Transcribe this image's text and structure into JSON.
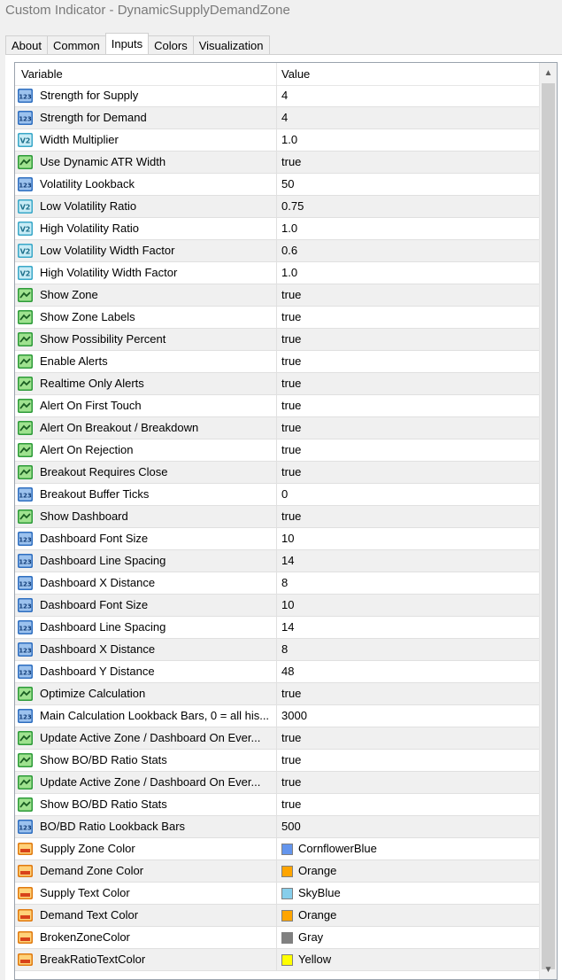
{
  "window": {
    "title": "Custom Indicator - DynamicSupplyDemandZone"
  },
  "tabs": [
    {
      "label": "About",
      "active": false
    },
    {
      "label": "Common",
      "active": false
    },
    {
      "label": "Inputs",
      "active": true
    },
    {
      "label": "Colors",
      "active": false
    },
    {
      "label": "Visualization",
      "active": false
    }
  ],
  "grid": {
    "columns": {
      "variable": "Variable",
      "value": "Value"
    },
    "rows": [
      {
        "type": "int",
        "label": "Strength for Supply",
        "value": "4"
      },
      {
        "type": "int",
        "label": "Strength for Demand",
        "value": "4"
      },
      {
        "type": "double",
        "label": "Width Multiplier",
        "value": "1.0"
      },
      {
        "type": "bool",
        "label": "Use Dynamic ATR Width",
        "value": "true"
      },
      {
        "type": "int",
        "label": "Volatility Lookback",
        "value": "50"
      },
      {
        "type": "double",
        "label": "Low Volatility Ratio",
        "value": "0.75"
      },
      {
        "type": "double",
        "label": "High Volatility Ratio",
        "value": "1.0"
      },
      {
        "type": "double",
        "label": "Low Volatility Width Factor",
        "value": "0.6"
      },
      {
        "type": "double",
        "label": "High Volatility Width Factor",
        "value": "1.0"
      },
      {
        "type": "bool",
        "label": "Show Zone",
        "value": "true"
      },
      {
        "type": "bool",
        "label": "Show Zone Labels",
        "value": "true"
      },
      {
        "type": "bool",
        "label": "Show Possibility Percent",
        "value": "true"
      },
      {
        "type": "bool",
        "label": "Enable Alerts",
        "value": "true"
      },
      {
        "type": "bool",
        "label": "Realtime Only Alerts",
        "value": "true"
      },
      {
        "type": "bool",
        "label": "Alert On First Touch",
        "value": "true"
      },
      {
        "type": "bool",
        "label": "Alert On Breakout / Breakdown",
        "value": "true"
      },
      {
        "type": "bool",
        "label": "Alert On Rejection",
        "value": "true"
      },
      {
        "type": "bool",
        "label": "Breakout Requires Close",
        "value": "true"
      },
      {
        "type": "int",
        "label": "Breakout Buffer Ticks",
        "value": "0"
      },
      {
        "type": "bool",
        "label": "Show Dashboard",
        "value": "true"
      },
      {
        "type": "int",
        "label": "Dashboard Font Size",
        "value": "10"
      },
      {
        "type": "int",
        "label": "Dashboard Line Spacing",
        "value": "14"
      },
      {
        "type": "int",
        "label": "Dashboard X Distance",
        "value": "8"
      },
      {
        "type": "int",
        "label": "Dashboard Font Size",
        "value": "10"
      },
      {
        "type": "int",
        "label": "Dashboard Line Spacing",
        "value": "14"
      },
      {
        "type": "int",
        "label": "Dashboard X Distance",
        "value": "8"
      },
      {
        "type": "int",
        "label": "Dashboard Y Distance",
        "value": "48"
      },
      {
        "type": "bool",
        "label": "Optimize Calculation",
        "value": "true"
      },
      {
        "type": "int",
        "label": "Main Calculation Lookback Bars, 0 = all his...",
        "value": "3000"
      },
      {
        "type": "bool",
        "label": "Update Active Zone / Dashboard On Ever...",
        "value": "true"
      },
      {
        "type": "bool",
        "label": "Show BO/BD Ratio Stats",
        "value": "true"
      },
      {
        "type": "bool",
        "label": "Update Active Zone / Dashboard On Ever...",
        "value": "true"
      },
      {
        "type": "bool",
        "label": "Show BO/BD Ratio Stats",
        "value": "true"
      },
      {
        "type": "int",
        "label": "BO/BD Ratio Lookback Bars",
        "value": "500"
      },
      {
        "type": "color",
        "label": "Supply Zone Color",
        "value": "CornflowerBlue",
        "color": "#6495ED"
      },
      {
        "type": "color",
        "label": "Demand Zone Color",
        "value": "Orange",
        "color": "#FFA500"
      },
      {
        "type": "color",
        "label": "Supply Text Color",
        "value": "SkyBlue",
        "color": "#87CEEB"
      },
      {
        "type": "color",
        "label": "Demand Text Color",
        "value": "Orange",
        "color": "#FFA500"
      },
      {
        "type": "color",
        "label": "BrokenZoneColor",
        "value": "Gray",
        "color": "#808080"
      },
      {
        "type": "color",
        "label": "BreakRatioTextColor",
        "value": "Yellow",
        "color": "#FFFF00"
      }
    ]
  },
  "icons": {
    "int": "int-type-icon",
    "double": "double-type-icon",
    "bool": "bool-type-icon",
    "color": "color-type-icon"
  }
}
